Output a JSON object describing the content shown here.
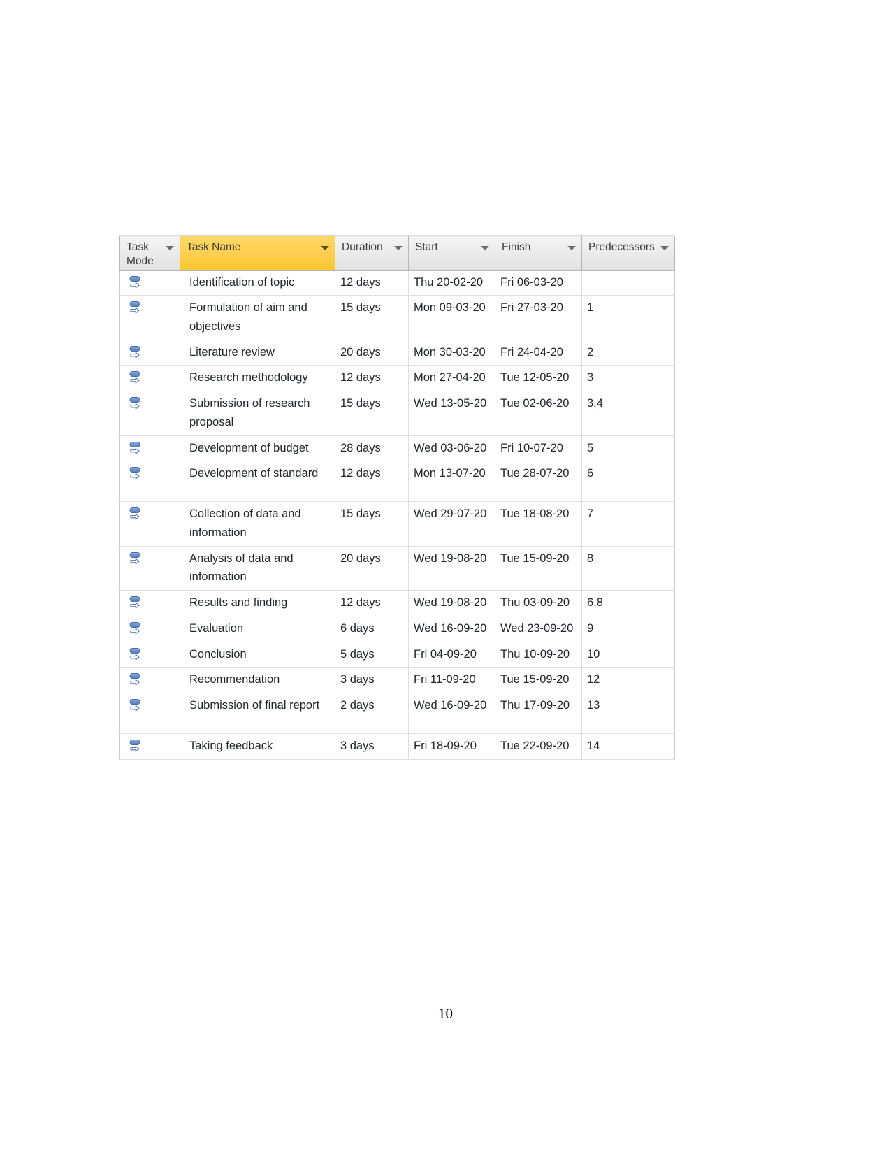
{
  "document": {
    "page_number": "10"
  },
  "project_table": {
    "columns": [
      {
        "key": "task_mode",
        "label": "Task\nMode",
        "icon": "chevron-down-icon",
        "selected": false
      },
      {
        "key": "task_name",
        "label": "Task Name",
        "icon": "chevron-down-icon",
        "selected": true
      },
      {
        "key": "duration",
        "label": "Duration",
        "icon": "chevron-down-icon",
        "selected": false
      },
      {
        "key": "start",
        "label": "Start",
        "icon": "chevron-down-icon",
        "selected": false
      },
      {
        "key": "finish",
        "label": "Finish",
        "icon": "chevron-down-icon",
        "selected": false
      },
      {
        "key": "predecessors",
        "label": "Predecessors",
        "icon": "chevron-down-icon",
        "selected": false
      }
    ],
    "header_selected_color": "#ffd055",
    "header_default_color": "#eaeaea",
    "task_mode_icon": "auto-scheduled-icon",
    "rows": [
      {
        "task_mode": "auto-scheduled-icon",
        "task_name": "Identification of topic",
        "duration": "12 days",
        "start": "Thu 20-02-20",
        "finish": "Fri 06-03-20",
        "predecessors": ""
      },
      {
        "task_mode": "auto-scheduled-icon",
        "task_name": "Formulation of aim and objectives",
        "duration": "15 days",
        "start": "Mon 09-03-20",
        "finish": "Fri 27-03-20",
        "predecessors": "1"
      },
      {
        "task_mode": "auto-scheduled-icon",
        "task_name": "Literature review",
        "duration": "20 days",
        "start": "Mon 30-03-20",
        "finish": "Fri 24-04-20",
        "predecessors": "2"
      },
      {
        "task_mode": "auto-scheduled-icon",
        "task_name": "Research methodology",
        "duration": "12 days",
        "start": "Mon 27-04-20",
        "finish": "Tue 12-05-20",
        "predecessors": "3"
      },
      {
        "task_mode": "auto-scheduled-icon",
        "task_name": "Submission of research proposal",
        "duration": "15 days",
        "start": "Wed 13-05-20",
        "finish": "Tue 02-06-20",
        "predecessors": "3,4"
      },
      {
        "task_mode": "auto-scheduled-icon",
        "task_name": "Development of budget",
        "duration": "28 days",
        "start": "Wed 03-06-20",
        "finish": "Fri 10-07-20",
        "predecessors": "5"
      },
      {
        "task_mode": "auto-scheduled-icon",
        "task_name": "Development of standard",
        "duration": "12 days",
        "start": "Mon 13-07-20",
        "finish": "Tue 28-07-20",
        "predecessors": "6"
      },
      {
        "task_mode": "auto-scheduled-icon",
        "task_name": "Collection of data and information",
        "duration": "15 days",
        "start": "Wed 29-07-20",
        "finish": "Tue 18-08-20",
        "predecessors": "7"
      },
      {
        "task_mode": "auto-scheduled-icon",
        "task_name": "Analysis of data and information",
        "duration": "20 days",
        "start": "Wed 19-08-20",
        "finish": "Tue 15-09-20",
        "predecessors": "8"
      },
      {
        "task_mode": "auto-scheduled-icon",
        "task_name": "Results and finding",
        "duration": "12 days",
        "start": "Wed 19-08-20",
        "finish": "Thu 03-09-20",
        "predecessors": "6,8"
      },
      {
        "task_mode": "auto-scheduled-icon",
        "task_name": "Evaluation",
        "duration": "6 days",
        "start": "Wed 16-09-20",
        "finish": "Wed 23-09-20",
        "predecessors": "9"
      },
      {
        "task_mode": "auto-scheduled-icon",
        "task_name": "Conclusion",
        "duration": "5 days",
        "start": "Fri 04-09-20",
        "finish": "Thu 10-09-20",
        "predecessors": "10"
      },
      {
        "task_mode": "auto-scheduled-icon",
        "task_name": "Recommendation",
        "duration": "3 days",
        "start": "Fri 11-09-20",
        "finish": "Tue 15-09-20",
        "predecessors": "12"
      },
      {
        "task_mode": "auto-scheduled-icon",
        "task_name": "Submission of final report",
        "duration": "2 days",
        "start": "Wed 16-09-20",
        "finish": "Thu 17-09-20",
        "predecessors": "13"
      },
      {
        "task_mode": "auto-scheduled-icon",
        "task_name": "Taking feedback",
        "duration": "3 days",
        "start": "Fri 18-09-20",
        "finish": "Tue 22-09-20",
        "predecessors": "14"
      }
    ],
    "row_is_tall": [
      false,
      true,
      false,
      false,
      true,
      false,
      true,
      true,
      true,
      false,
      false,
      false,
      false,
      true,
      false
    ]
  }
}
